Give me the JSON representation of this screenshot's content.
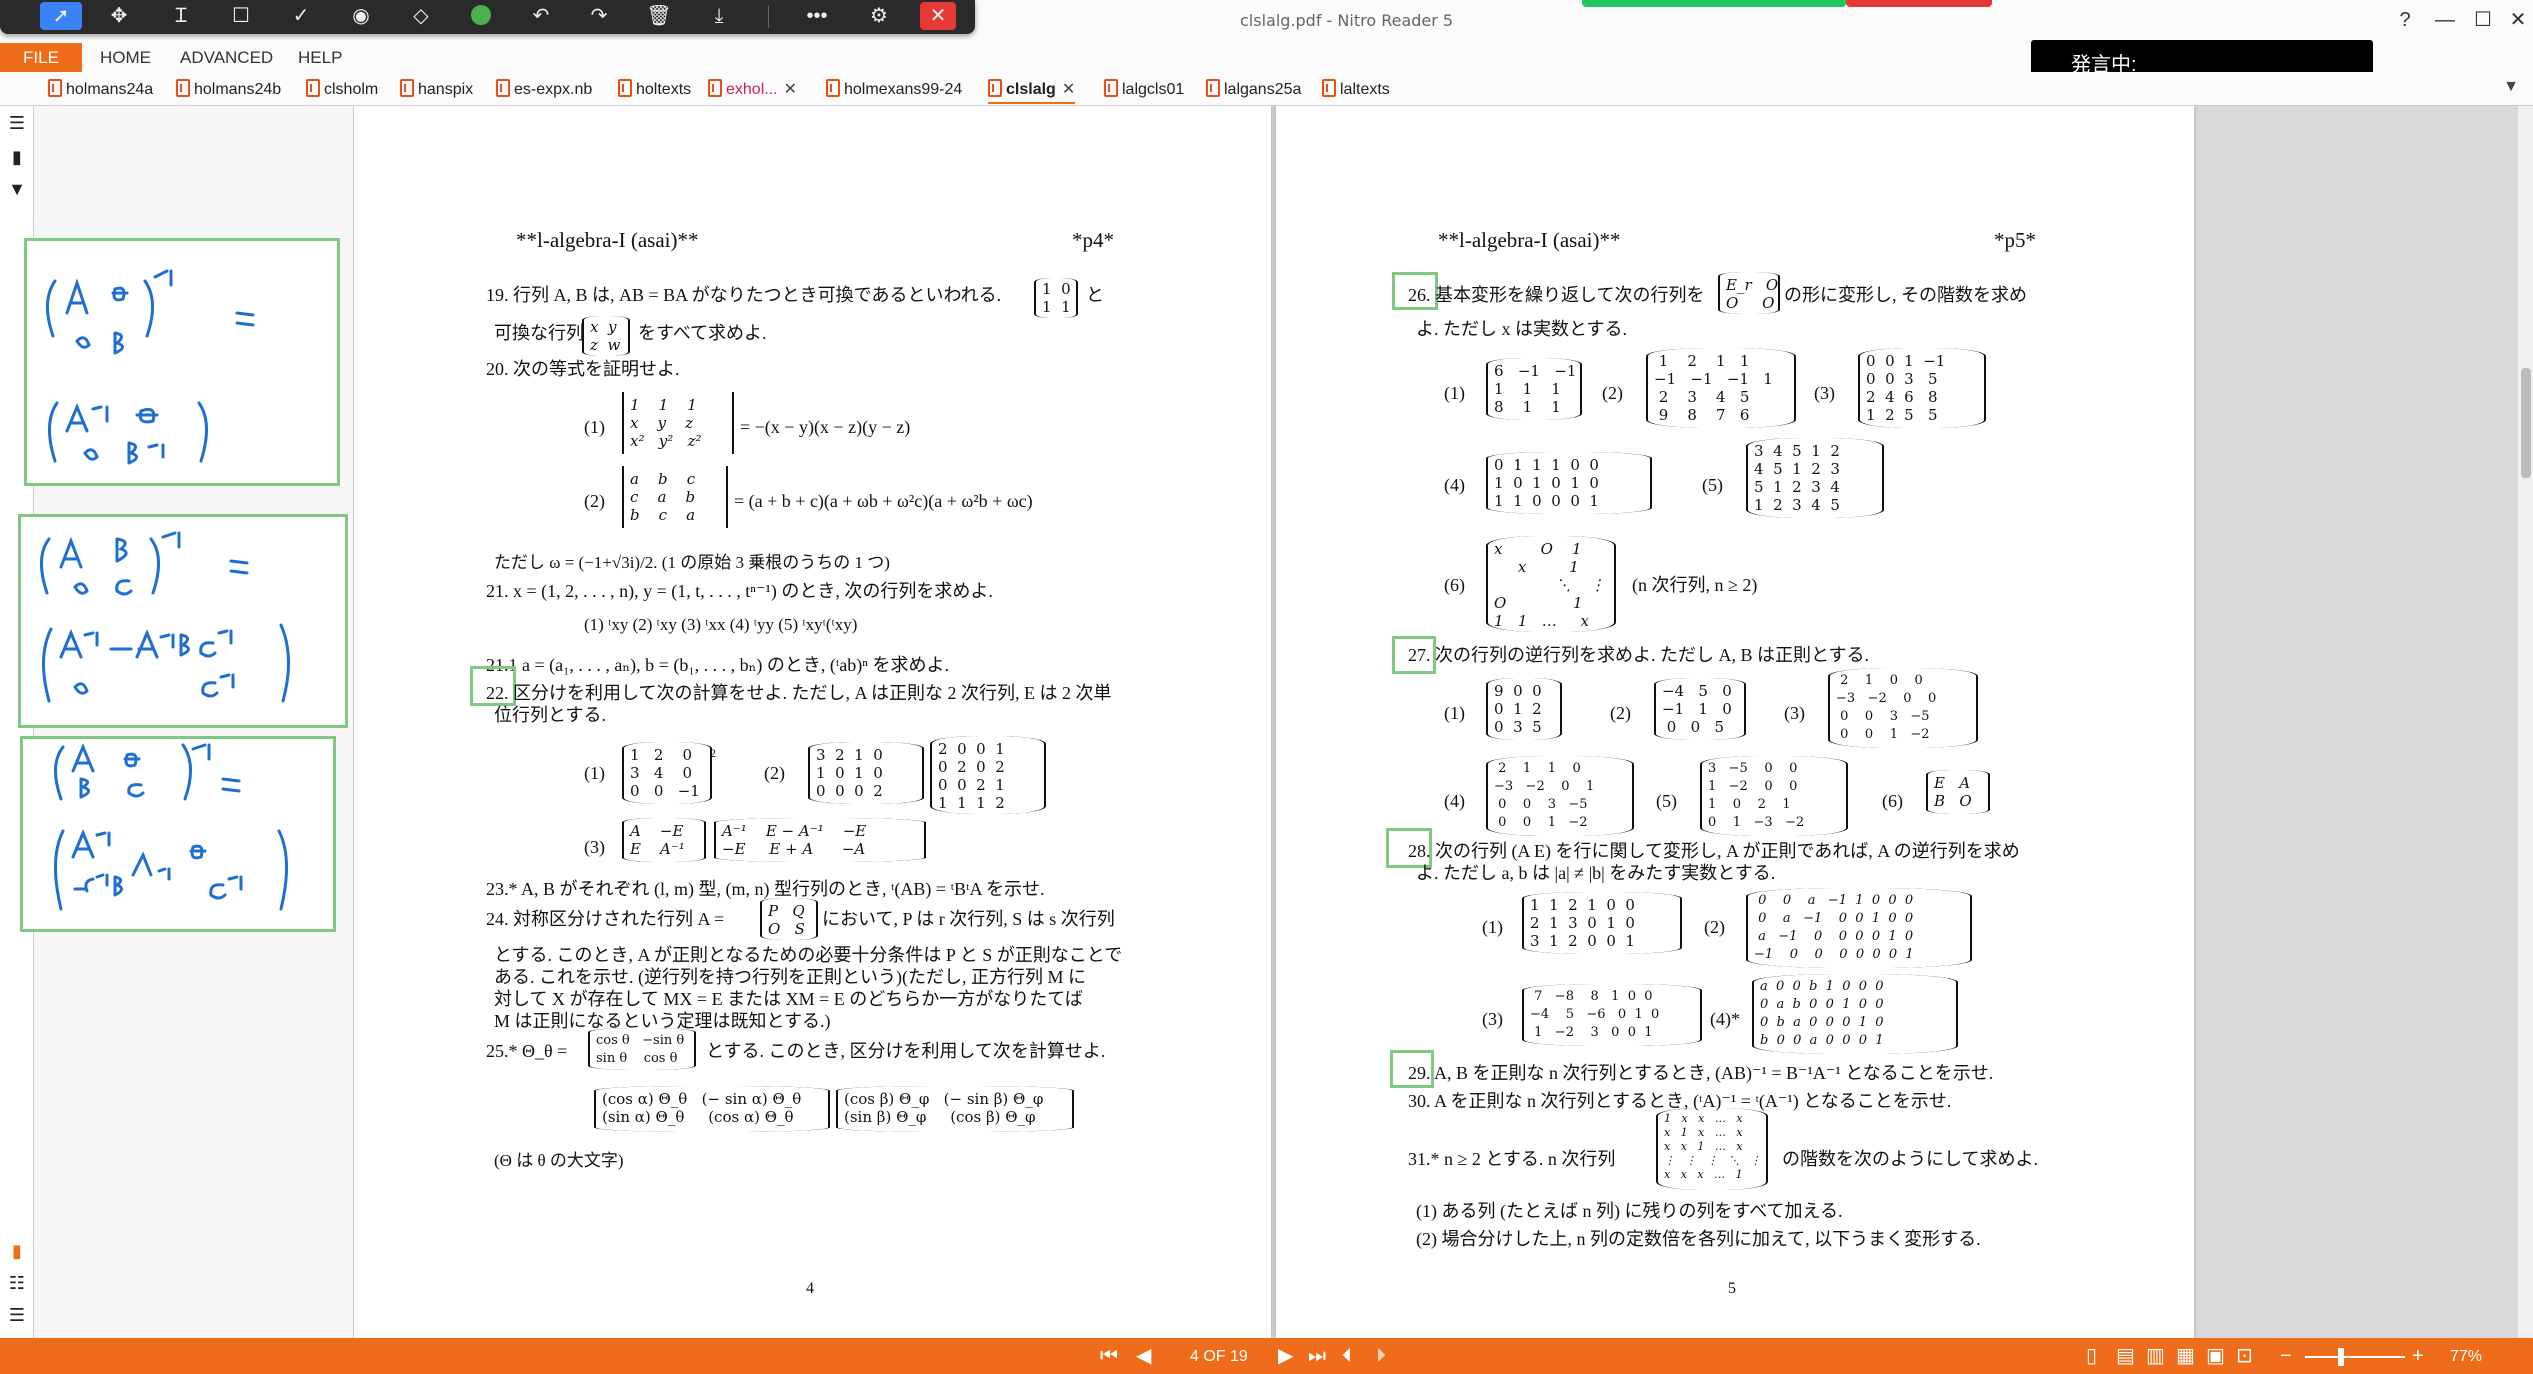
{
  "window": {
    "title": "clslalg.pdf - Nitro Reader 5",
    "tts_label": "発言中:"
  },
  "menu": {
    "file": "FILE",
    "items": [
      "HOME",
      "ADVANCED",
      "HELP"
    ]
  },
  "tabs": [
    {
      "label": "holmans24a"
    },
    {
      "label": "holmans24b"
    },
    {
      "label": "clsholm"
    },
    {
      "label": "hanspix"
    },
    {
      "label": "es-expx.nb"
    },
    {
      "label": "holtexts"
    },
    {
      "label": "exhol...",
      "close": "✕"
    },
    {
      "label": "holmexans99-24"
    },
    {
      "label": "clslalg",
      "close": "✕"
    },
    {
      "label": "lalgcls01"
    },
    {
      "label": "lalgans25a"
    },
    {
      "label": "laltexts"
    }
  ],
  "icons": {
    "select": "cursor-arrow-icon",
    "pan": "move-icon",
    "text": "text-cursor-icon",
    "rect": "rectangle-icon",
    "check": "checkmark-icon",
    "stamp": "stamp-icon",
    "eraser": "eraser-icon",
    "color": "color-dot-icon",
    "undo": "undo-icon",
    "redo": "redo-icon",
    "delete": "trash-icon",
    "save": "download-icon",
    "more": "more-icon",
    "user": "user-settings-icon",
    "close": "close-icon"
  },
  "colors": {
    "accent": "#ef6c1a",
    "highlight_box": "#7fc982",
    "ink": "#1f6fd1"
  },
  "page_left": {
    "header_left": "**l-algebra-I (asai)**",
    "header_right": "*p4*",
    "q19": "19.  行列 A, B は, AB = BA がなりたつとき可換であるといわれる.",
    "q19_b": "可換な行列",
    "q19_c": "をすべて求めよ.",
    "q19_and": "と",
    "q20": "20.  次の等式を証明せよ.",
    "q20_1_rhs": "= −(x − y)(x − z)(y − z)",
    "q20_2_rhs": "= (a + b + c)(a + ωb + ω²c)(a + ω²b + ωc)",
    "omega_note": "ただし ω = (−1+√3i)/2.  (1 の原始 3 乗根のうちの 1 つ)",
    "q21": "21.  x = (1, 2, . . . , n), y = (1, t, . . . , tⁿ⁻¹) のとき, 次の行列を求めよ.",
    "q21_opts": "(1) ᵗxy     (2) ᵗxy     (3) ᵗxx     (4) ᵗyy     (5) ᵗxyᵗ(ᵗxy)",
    "q21_1": "21.1  a = (a₁, . . . , aₙ), b = (b₁, . . . , bₙ) のとき, (ᵗab)ⁿ を求めよ.",
    "q22": "22.  区分けを利用して次の計算をせよ. ただし, A は正則な 2 次行列, E は 2 次単",
    "q22_b": "位行列とする.",
    "q23": "23.*  A, B がそれぞれ (l, m) 型, (m, n) 型行列のとき, ᵗ(AB) = ᵗBᵗA を示せ.",
    "q24": "24.  対称区分けされた行列 A =",
    "q24_b": "において, P は r 次行列, S は s 次行列",
    "q24_c": "とする. このとき, A が正則となるための必要十分条件は P と S が正則なことで",
    "q24_d": "ある. これを示せ. (逆行列を持つ行列を正則という)(ただし, 正方行列 M に",
    "q24_e": "対して X が存在して MX = E または XM = E のどちらか一方がなりたてば",
    "q24_f": "M は正則になるという定理は既知とする.)",
    "q25": "25.*  Θ_θ =",
    "q25_b": "とする. このとき, 区分けを利用して次を計算せよ.",
    "theta_note": "(Θ は θ の大文字)",
    "page_number": "4"
  },
  "page_right": {
    "header_left": "**l-algebra-I (asai)**",
    "header_right": "*p5*",
    "q26": "26.  基本変形を繰り返して次の行列を",
    "q26_b": "の形に変形し, その階数を求め",
    "q26_c": "よ. ただし x は実数とする.",
    "q26_6_note": "(n 次行列, n ≥ 2)",
    "q27": "27.  次の行列の逆行列を求めよ. ただし A, B は正則とする.",
    "q28": "28.  次の行列 (A  E) を行に関して変形し, A が正則であれば, A の逆行列を求め",
    "q28_b": "よ. ただし a, b は |a| ≠ |b| をみたす実数とする.",
    "q29": "29.  A, B を正則な n 次行列とするとき, (AB)⁻¹ = B⁻¹A⁻¹ となることを示せ.",
    "q30": "30.  A を正則な n 次行列とするとき, (ᵗA)⁻¹ = ᵗ(A⁻¹) となることを示せ.",
    "q31": "31.*  n ≥ 2 とする. n 次行列",
    "q31_b": "の階数を次のようにして求めよ.",
    "q31_1": "(1) ある列 (たとえば n 列) に残りの列をすべて加える.",
    "q31_2": "(2) 場合分けした上, n 列の定数倍を各列に加えて, 以下うまく変形する.",
    "page_number": "5"
  },
  "status": {
    "page_indicator": "4 OF 19",
    "zoom": "77%"
  }
}
